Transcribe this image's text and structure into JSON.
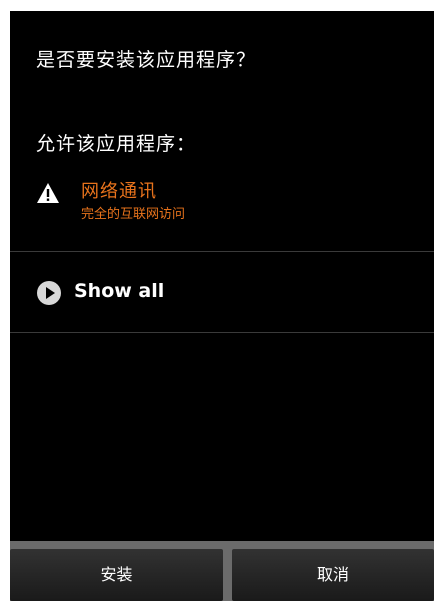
{
  "dialog": {
    "question": "是否要安装该应用程序？",
    "allow_title": "允许该应用程序：",
    "permission": {
      "title": "网络通讯",
      "subtitle": "完全的互联网访问",
      "icon": "warning-icon"
    },
    "show_all": {
      "label": "Show all",
      "icon": "play-icon"
    },
    "buttons": {
      "install": "安装",
      "cancel": "取消"
    }
  },
  "colors": {
    "background": "#000000",
    "warning_text": "#e8731c",
    "text": "#ffffff"
  }
}
